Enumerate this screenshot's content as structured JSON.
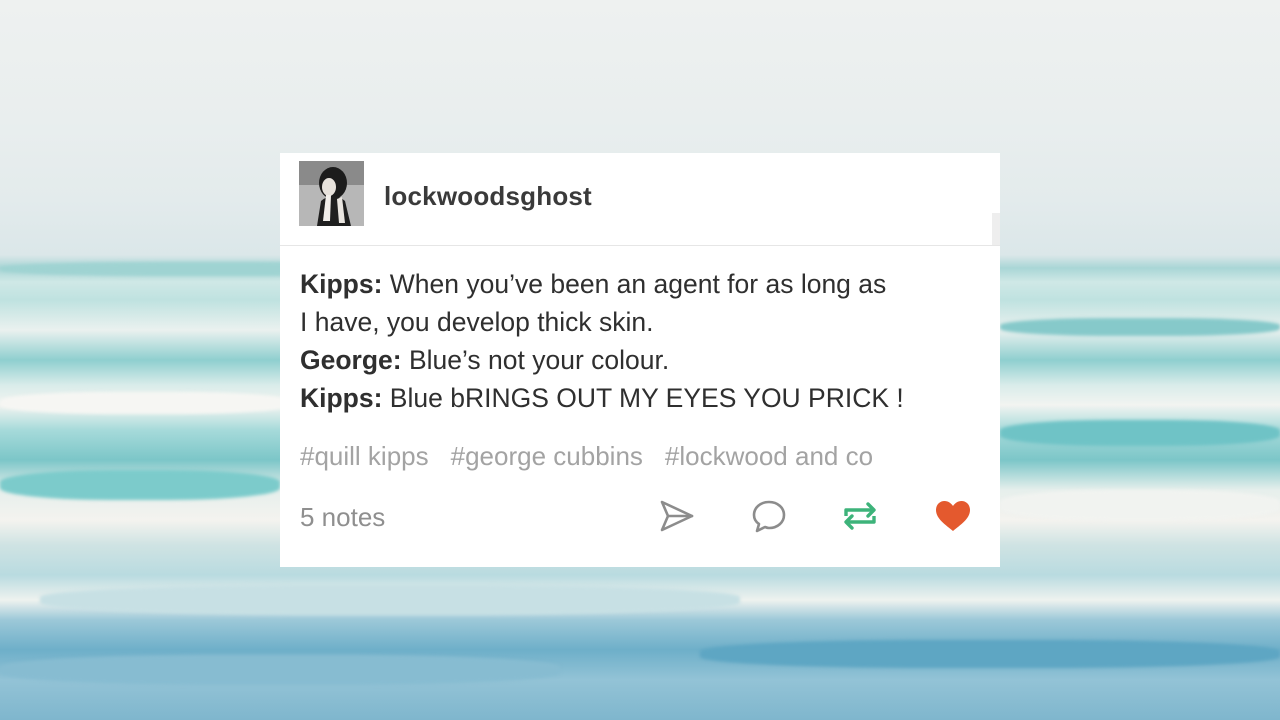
{
  "post": {
    "username": "lockwoodsghost",
    "dialogue": [
      {
        "speaker": "Kipps:",
        "text": " When you’ve been an agent for as long as"
      },
      {
        "speaker": "",
        "text": "I have, you develop thick skin."
      },
      {
        "speaker": "George:",
        "text": " Blue’s not your colour."
      },
      {
        "speaker": "Kipps:",
        "text": " Blue bRINGS OUT MY EYES YOU PRICK !"
      }
    ],
    "tags": [
      "#quill kipps",
      "#george cubbins",
      "#lockwood and co"
    ],
    "notes": "5 notes"
  },
  "icons": {
    "avatar": "profile-photo-person-covering-face",
    "share": "paper-plane-icon",
    "reply": "speech-bubble-icon",
    "reblog": "reblog-arrows-icon",
    "like": "heart-icon"
  },
  "colors": {
    "reblog": "#3db37a",
    "like": "#e4592e",
    "tag_text": "#a3a3a3",
    "body_text": "#2f2f2f"
  }
}
